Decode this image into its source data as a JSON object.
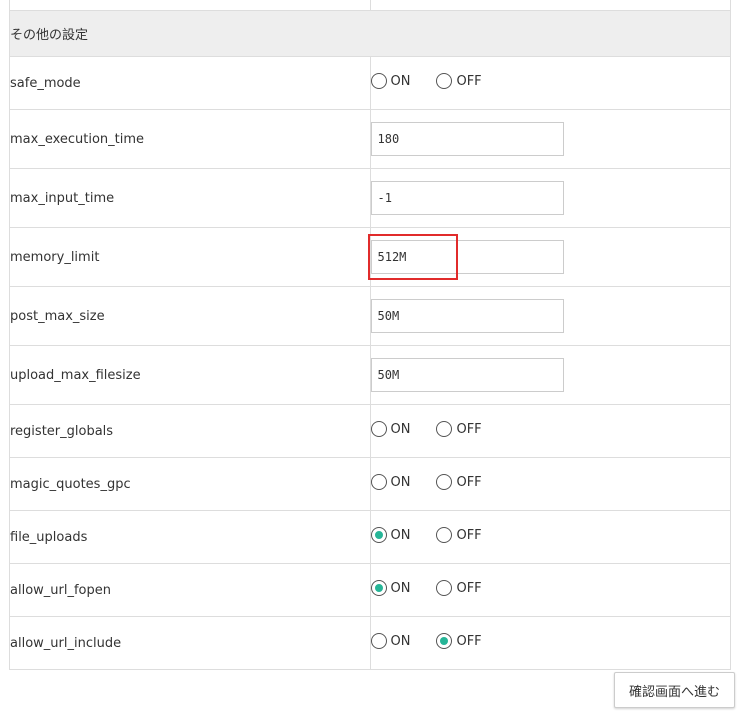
{
  "section": {
    "title": "その他の設定"
  },
  "settings": [
    {
      "key": "safe_mode",
      "type": "radio",
      "selected": "none",
      "on_label": "ON",
      "off_label": "OFF"
    },
    {
      "key": "max_execution_time",
      "type": "input",
      "value": "180"
    },
    {
      "key": "max_input_time",
      "type": "input",
      "value": "-1"
    },
    {
      "key": "memory_limit",
      "type": "input",
      "value": "512M",
      "highlighted": true
    },
    {
      "key": "post_max_size",
      "type": "input",
      "value": "50M"
    },
    {
      "key": "upload_max_filesize",
      "type": "input",
      "value": "50M"
    },
    {
      "key": "register_globals",
      "type": "radio",
      "selected": "none",
      "on_label": "ON",
      "off_label": "OFF"
    },
    {
      "key": "magic_quotes_gpc",
      "type": "radio",
      "selected": "none",
      "on_label": "ON",
      "off_label": "OFF"
    },
    {
      "key": "file_uploads",
      "type": "radio",
      "selected": "on",
      "on_label": "ON",
      "off_label": "OFF"
    },
    {
      "key": "allow_url_fopen",
      "type": "radio",
      "selected": "on",
      "on_label": "ON",
      "off_label": "OFF"
    },
    {
      "key": "allow_url_include",
      "type": "radio",
      "selected": "off",
      "on_label": "ON",
      "off_label": "OFF"
    }
  ],
  "actions": {
    "confirm_label": "確認画面へ進む"
  },
  "colors": {
    "radio_checked": "#26b597",
    "highlight_border": "#e12b2b",
    "header_background": "#eeeeee"
  }
}
